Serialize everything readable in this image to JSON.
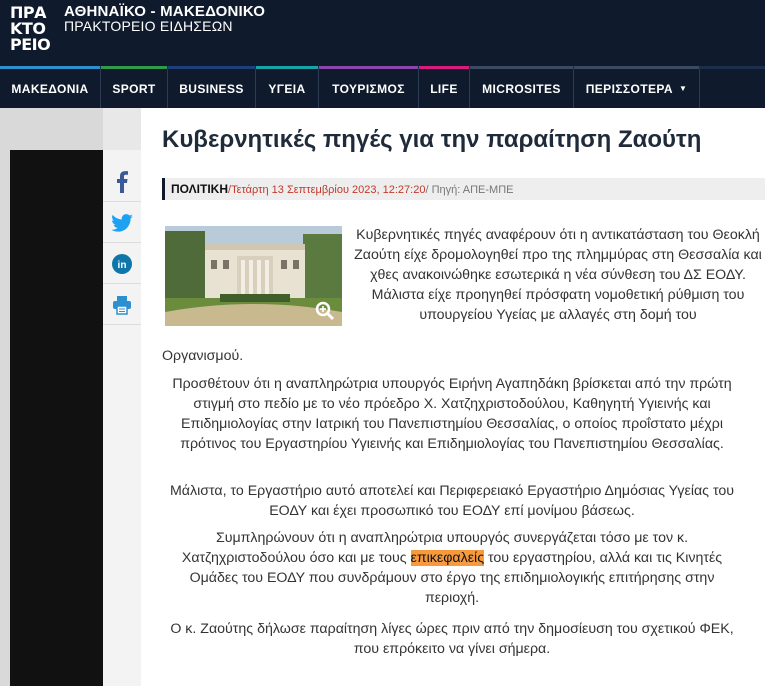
{
  "site": {
    "logo_lines": [
      "ΠΡΑ",
      "ΚΤΟ",
      "ΡΕΙΟ"
    ],
    "title": "ΑΘΗΝΑΪΚΟ - ΜΑΚΕΔΟΝΙΚΟ",
    "subtitle": "ΠΡΑΚΤΟΡΕΙΟ ΕΙΔΗΣΕΩΝ"
  },
  "nav": {
    "items": [
      {
        "label": "ΜΑΚΕΔΟΝΙΑ",
        "accent": "#2d8fd0"
      },
      {
        "label": "SPORT",
        "accent": "#2e9a4a"
      },
      {
        "label": "BUSINESS",
        "accent": "#1f3f7a"
      },
      {
        "label": "ΥΓΕΙΑ",
        "accent": "#17a2a8"
      },
      {
        "label": "ΤΟΥΡΙΣΜΟΣ",
        "accent": "#8e44ad"
      },
      {
        "label": "LIFE",
        "accent": "#d81b7c"
      },
      {
        "label": "MICROSITES",
        "accent": "#3a4a63"
      },
      {
        "label": "ΠΕΡΙΣΣΟΤΕΡΑ",
        "accent": "#3a4a63"
      }
    ]
  },
  "share": {
    "icons": [
      "facebook-icon",
      "twitter-icon",
      "linkedin-icon",
      "print-icon"
    ]
  },
  "article": {
    "title": "Κυβερνητικές πηγές για την παραίτηση Ζαούτη",
    "category": "ΠΟΛΙΤΙΚΗ",
    "date": "/Τετάρτη 13 Σεπτεμβρίου 2023, 12:27:20",
    "source": "/ Πηγή: ΑΠΕ-ΜΠΕ",
    "p1": "Κυβερνητικές πηγές αναφέρουν ότι η αντικατάσταση του Θεοκλή Ζαούτη είχε δρομολογηθεί προ της πλημμύρας στη Θεσσαλία και χθες ανακοινώθηκε εσωτερικά η νέα σύνθεση του ΔΣ ΕΟΔΥ. Μάλιστα είχε προηγηθεί πρόσφατη νομοθετική ρύθμιση του υπουργείου Υγείας με αλλαγές στη δομή του",
    "p1_end": "Οργανισμού.",
    "p2": "Προσθέτουν ότι η αναπληρώτρια υπουργός Ειρήνη Αγαπηδάκη βρίσκεται από την πρώτη στιγμή στο πεδίο με το νέο πρόεδρο Χ. Χατζηχριστοδούλου, Καθηγητή Υγιεινής και Επιδημιολογίας στην Ιατρική του Πανεπιστημίου Θεσσαλίας, ο οποίος προΐστατο μέχρι πρότινος του Εργαστηρίου Υγιεινής και Επιδημιολογίας του Πανεπιστημίου Θεσσαλίας.",
    "p3": "Μάλιστα, το Εργαστήριο αυτό αποτελεί και Περιφερειακό Εργαστήριο Δημόσιας Υγείας του ΕΟΔΥ και έχει προσωπικό του ΕΟΔΥ επί μονίμου βάσεως.",
    "p4_before": "Συμπληρώνουν ότι η αναπληρώτρια υπουργός συνεργάζεται τόσο με τον κ. Χατζηχριστοδούλου όσο και με τους ",
    "p4_highlight": "επικεφαλείς",
    "p4_after": " του εργαστηρίου, αλλά και τις Κινητές Ομάδες του ΕΟΔΥ που συνδράμουν στο έργο της επιδημιολογικής επιτήρησης στην περιοχή.",
    "p5": "Ο κ. Ζαούτης δήλωσε παραίτηση λίγες ώρες πριν από την δημοσίευση του σχετικού ΦΕΚ, που επρόκειτο να γίνει σήμερα."
  }
}
